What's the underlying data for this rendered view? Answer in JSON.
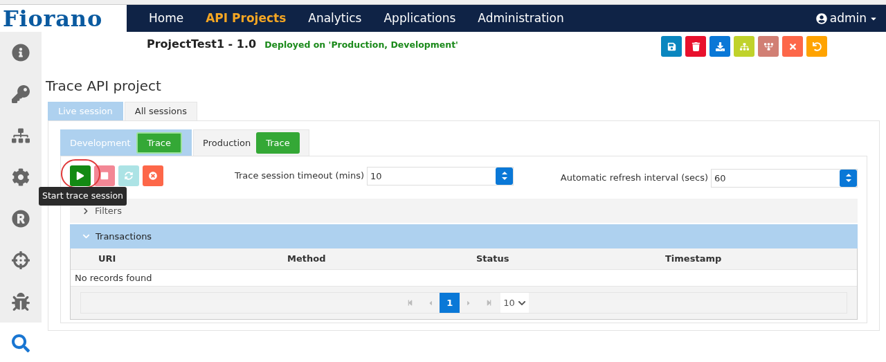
{
  "logo": {
    "text": "Fiorano"
  },
  "nav": [
    {
      "label": "Home",
      "selected": false
    },
    {
      "label": "API Projects",
      "selected": true
    },
    {
      "label": "Analytics",
      "selected": false
    },
    {
      "label": "Applications",
      "selected": false
    },
    {
      "label": "Administration",
      "selected": false
    }
  ],
  "user": {
    "name": "admin"
  },
  "sidebar": [
    {
      "kind": "info",
      "selected": false
    },
    {
      "kind": "key",
      "selected": false
    },
    {
      "kind": "flow",
      "selected": false
    },
    {
      "kind": "settings",
      "selected": false
    },
    {
      "kind": "registered",
      "selected": false
    },
    {
      "kind": "target",
      "selected": false
    },
    {
      "kind": "bug",
      "selected": false
    },
    {
      "kind": "search",
      "selected": true
    }
  ],
  "project": {
    "title": "ProjectTest1 - 1.0",
    "status": "Deployed on 'Production, Development'"
  },
  "toolbar": [
    {
      "kind": "save",
      "color": "#0a86bf"
    },
    {
      "kind": "delete",
      "color": "#e8112d"
    },
    {
      "kind": "download",
      "color": "#0a78d7"
    },
    {
      "kind": "tree",
      "color": "#c0d22b"
    },
    {
      "kind": "tree-reverse",
      "color": "#d17f74"
    },
    {
      "kind": "close",
      "color": "#fd6749"
    },
    {
      "kind": "undo",
      "color": "#ffa300"
    }
  ],
  "page_title": "Trace API project",
  "tabs": [
    {
      "label": "Live session",
      "selected": true
    },
    {
      "label": "All sessions",
      "selected": false
    }
  ],
  "env_tabs": [
    {
      "label": "Development",
      "selected": true,
      "action": "Trace"
    },
    {
      "label": "Production",
      "selected": false,
      "action": "Trace"
    }
  ],
  "session_buttons": [
    {
      "kind": "start",
      "disabled": false
    },
    {
      "kind": "stop",
      "disabled": true
    },
    {
      "kind": "refresh",
      "disabled": true
    },
    {
      "kind": "clear",
      "disabled": false
    }
  ],
  "tooltip": "Start trace session",
  "fields": [
    {
      "label": "Trace session timeout (mins)",
      "value": "10"
    },
    {
      "label": "Automatic refresh interval (secs)",
      "value": "60"
    }
  ],
  "filters": {
    "label": "Filters",
    "expanded": false
  },
  "transactions": {
    "label": "Transactions",
    "expanded": true,
    "columns": [
      "URI",
      "Method",
      "Status",
      "Timestamp"
    ],
    "empty_message": "No records found",
    "pages": [
      {
        "label": "1",
        "selected": true
      }
    ],
    "page_size": "10"
  }
}
